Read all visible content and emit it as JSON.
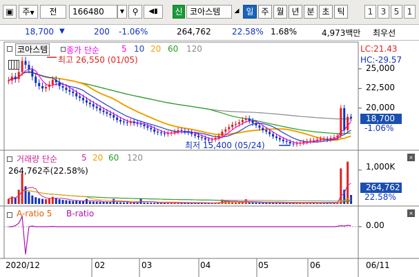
{
  "toolbar": {
    "mode_label": "주",
    "jeon_label": "전",
    "code_value": "166480",
    "sin_label": "신",
    "stock_name": "코아스템",
    "periods": [
      "일",
      "주",
      "월",
      "년",
      "분",
      "초",
      "틱"
    ],
    "active_period": "일",
    "numbers": [
      "1",
      "3",
      "5",
      "1"
    ]
  },
  "quote": {
    "price": "18,700",
    "change": "200",
    "change_pct": "-1.06%",
    "volume": "264,762",
    "volume_ratio": "22.58%",
    "turnover_pct": "1.68%",
    "trade_amount": "4,973백만",
    "priority": "최우선"
  },
  "price_panel": {
    "stock_tag": "코아스템",
    "legend_prefix": "종가 단순",
    "ma_periods": [
      "5",
      "10",
      "20",
      "60",
      "120"
    ],
    "ma_colors": [
      "#ff00ff",
      "#1f3fbf",
      "#f0a000",
      "#1f9f1f",
      "#8a8a8a"
    ],
    "high_annotation": "최고 26,550 (01/05)",
    "low_annotation": "최저 15,400 (05/24)",
    "lc_label": "LC:21.43",
    "hc_label": "HC:-29.57",
    "y_ticks": [
      "25,000",
      "22,500",
      "20,000"
    ],
    "current_price_box": "18,700",
    "current_change_box": "-1.06%"
  },
  "volume_panel": {
    "title": "거래량 단순",
    "ma_periods": [
      "5",
      "20",
      "60",
      "120"
    ],
    "ma_colors": [
      "#d02090",
      "#f0a000",
      "#1f9f1f",
      "#8a8a8a"
    ],
    "summary": "264,762주(22.58%)",
    "y_tick": "1,000K",
    "current_volume_box": "264,762",
    "current_ratio_box": "22.58%"
  },
  "ratio_panel": {
    "a_label": "A-ratio 5",
    "b_label": "B-ratio",
    "y_tick": "0.00"
  },
  "x_axis": {
    "labels": [
      "2020/12",
      "02",
      "03",
      "04",
      "05",
      "06"
    ],
    "end_label": "06/11"
  },
  "chart_data": {
    "type": "candlestick",
    "price": {
      "ylim": [
        15000,
        27000
      ],
      "high": {
        "value": 26550,
        "date": "01/05"
      },
      "low": {
        "value": 15400,
        "date": "05/24"
      },
      "last": 18700,
      "closes": [
        23500,
        24000,
        23700,
        24600,
        26000,
        25500,
        24900,
        24000,
        23200,
        22800,
        22500,
        22700,
        23000,
        23600,
        23300,
        22800,
        22600,
        22300,
        22100,
        21900,
        21500,
        21300,
        21000,
        20700,
        20500,
        20200,
        20000,
        19700,
        19500,
        19300,
        19100,
        18800,
        18500,
        18300,
        18200,
        18100,
        18300,
        18100,
        18000,
        17900,
        17700,
        17500,
        17300,
        17000,
        16900,
        16800,
        16700,
        16800,
        16900,
        17000,
        17200,
        17100,
        17000,
        16900,
        16700,
        16500,
        16300,
        16200,
        16000,
        15900,
        16000,
        16200,
        16500,
        17000,
        17300,
        17600,
        17900,
        18000,
        18200,
        18500,
        18700,
        18400,
        18100,
        17800,
        17500,
        17200,
        17000,
        16700,
        16400,
        16200,
        16000,
        15800,
        15700,
        15500,
        15400,
        15500,
        15600,
        15700,
        15800,
        15900,
        15900,
        16000,
        16100,
        16100,
        16000,
        16200,
        16300,
        16500,
        20000,
        17200,
        18900,
        18700
      ]
    },
    "volume": {
      "ylim": [
        0,
        1200000
      ],
      "last": 264762,
      "values": [
        150000,
        220000,
        180000,
        420000,
        900000,
        520000,
        360000,
        250000,
        200000,
        170000,
        150000,
        140000,
        160000,
        210000,
        180000,
        140000,
        120000,
        110000,
        100000,
        90000,
        95000,
        85000,
        80000,
        150000,
        75000,
        70000,
        68000,
        65000,
        60000,
        58000,
        56000,
        150000,
        55000,
        50000,
        48000,
        52000,
        46000,
        45000,
        44000,
        160000,
        42000,
        40000,
        38000,
        37000,
        36000,
        35000,
        34000,
        33000,
        35000,
        36000,
        34000,
        33000,
        32000,
        31000,
        30000,
        30000,
        29000,
        28000,
        28000,
        27000,
        29000,
        33000,
        45000,
        130000,
        85000,
        70000,
        60000,
        55000,
        50000,
        48000,
        140000,
        45000,
        43000,
        41000,
        40000,
        38000,
        36000,
        35000,
        34000,
        33000,
        32000,
        31000,
        30000,
        30000,
        29000,
        29000,
        30000,
        31000,
        30000,
        30000,
        29000,
        30000,
        31000,
        30000,
        29000,
        31000,
        35000,
        42000,
        1050000,
        420000,
        1250000,
        264762
      ]
    },
    "ratio": {
      "a_values": [
        0,
        0,
        0.3,
        1,
        3,
        -8,
        0,
        0.2,
        0,
        0,
        0,
        0,
        0,
        0.1,
        0,
        0,
        0,
        0,
        0,
        0,
        0,
        0,
        0,
        0,
        0,
        0,
        0,
        0,
        0,
        0,
        0,
        0,
        0,
        0,
        0,
        0,
        0,
        0,
        0,
        0,
        0,
        0,
        0,
        0,
        0,
        0,
        0,
        0,
        0,
        0,
        0,
        0,
        0,
        0,
        0,
        0,
        0,
        0,
        0,
        0,
        0,
        0,
        0,
        0,
        0,
        0,
        0,
        0,
        0,
        0,
        0,
        0,
        0,
        0,
        0,
        0,
        0,
        0,
        0,
        0,
        0,
        0,
        0,
        0,
        0,
        0,
        0,
        0,
        0,
        0,
        0,
        0,
        0,
        0,
        0,
        0,
        0,
        0.1,
        0.3,
        0.2,
        0.4,
        0.3
      ]
    }
  }
}
